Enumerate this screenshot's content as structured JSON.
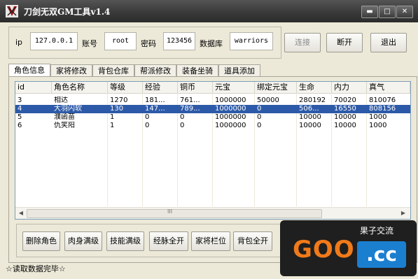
{
  "window": {
    "title": "刀剑无双GM工具v1.4",
    "buttons": {
      "minimize": "▬",
      "maximize": "□",
      "close": "✕"
    }
  },
  "connection": {
    "ip_label": "ip",
    "ip_value": "127.0.0.1",
    "account_label": "账号",
    "account_value": "root",
    "password_label": "密码",
    "password_value": "123456",
    "database_label": "数据库",
    "database_value": "warriors",
    "connect_button": "连接",
    "disconnect_button": "断开",
    "exit_button": "退出"
  },
  "tabs": [
    "角色信息",
    "家将修改",
    "背包仓库",
    "帮派修改",
    "装备坐骑",
    "道具添加"
  ],
  "grid": {
    "columns": [
      "id",
      "角色名称",
      "等级",
      "经验",
      "铜币",
      "元宝",
      "绑定元宝",
      "生命",
      "内力",
      "真气"
    ],
    "rows": [
      [
        "3",
        "相达",
        "1270",
        "181...",
        "761...",
        "1000000",
        "50000",
        "280192",
        "70020",
        "810076"
      ],
      [
        "4",
        "大羽闪软",
        "130",
        "147...",
        "789...",
        "1000000",
        "0",
        "506...",
        "16550",
        "808156"
      ],
      [
        "5",
        "濮函苗",
        "1",
        "0",
        "0",
        "1000000",
        "0",
        "10000",
        "10000",
        "1000"
      ],
      [
        "6",
        "仇笑阳",
        "1",
        "0",
        "0",
        "1000000",
        "0",
        "10000",
        "10000",
        "1000"
      ]
    ],
    "selected_row_index": 1,
    "scroll_center_glyph": "III"
  },
  "actions": [
    "删除角色",
    "肉身满级",
    "技能满级",
    "经脉全开",
    "家将栏位",
    "背包全开"
  ],
  "status_text": "☆读取数据完毕☆",
  "watermark": {
    "logo": "GOO",
    "cc": ".cc",
    "text": "果子交流"
  },
  "colors": {
    "selection": "#2d5aa8",
    "titlebar": "#3a3a3a",
    "window_bg": "#ece9d8"
  }
}
